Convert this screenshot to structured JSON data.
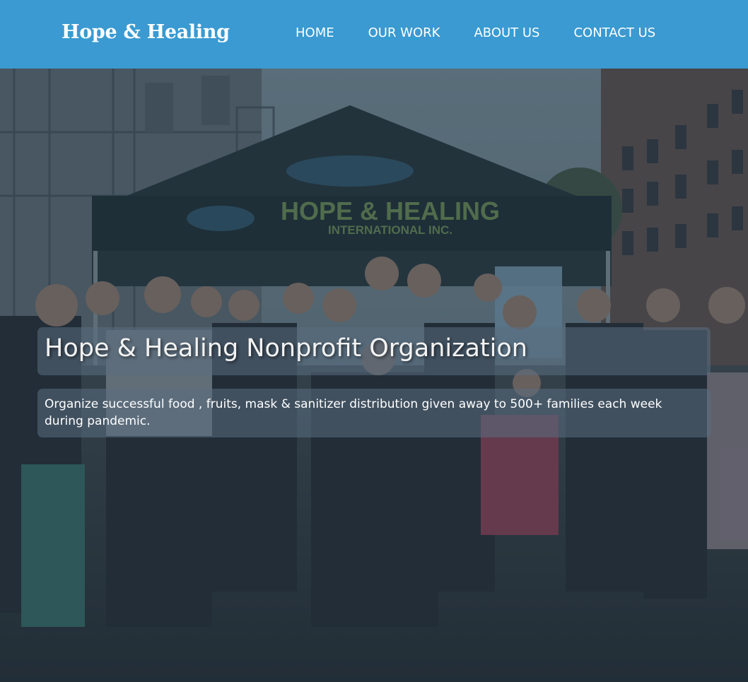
{
  "colors": {
    "navbar_bg": "#3a9ad1",
    "nav_text": "#ffffff",
    "overlay": "#1c2e3c"
  },
  "brand": {
    "name": "Hope & Healing"
  },
  "nav": {
    "items": [
      {
        "label": "HOME"
      },
      {
        "label": "OUR WORK"
      },
      {
        "label": "ABOUT US"
      },
      {
        "label": "CONTACT US"
      }
    ]
  },
  "hero": {
    "headline": "Hope & Healing Nonprofit Organization",
    "subtext": "Organize successful food , fruits, mask & sanitizer distribution given away to 500+ families each week during pandemic.",
    "image": {
      "tent_title": "HOPE & HEALING",
      "tent_subtitle": "INTERNATIONAL INC."
    }
  }
}
